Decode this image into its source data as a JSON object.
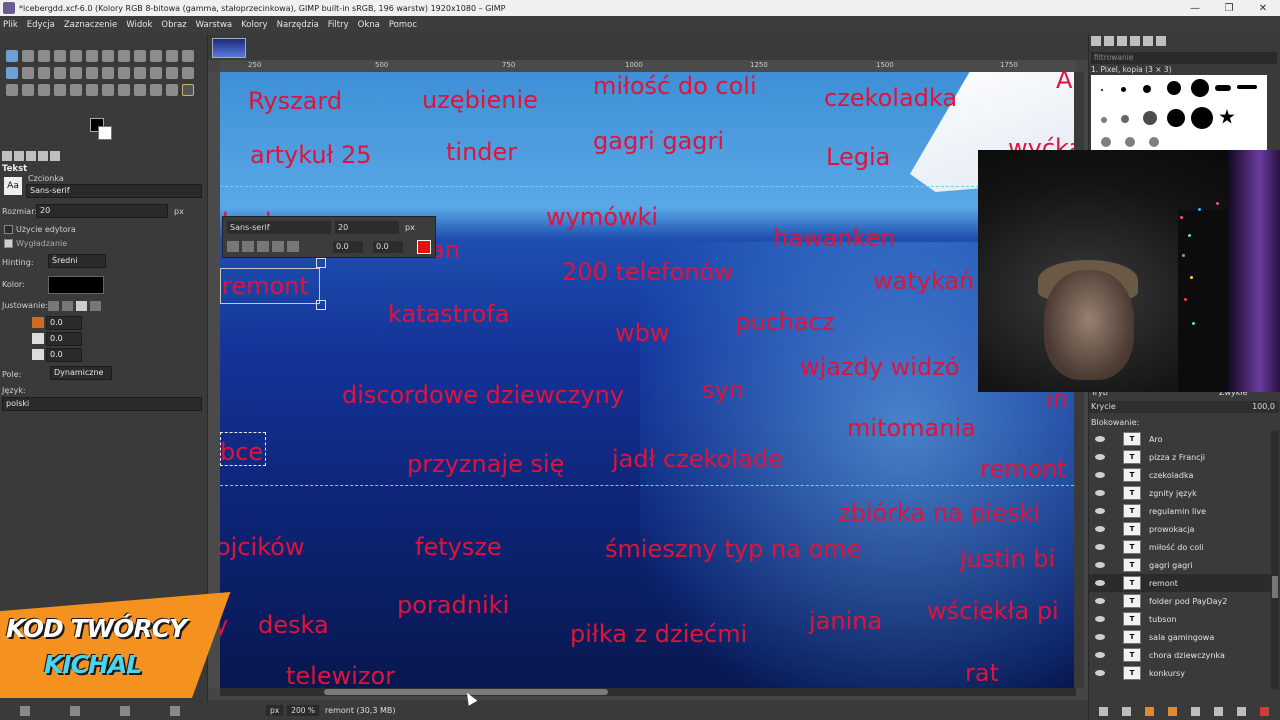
{
  "window": {
    "title": "*icebergdd.xcf-6.0 (Kolory RGB 8-bitowa (gamma, stałoprzecinkowa), GIMP built-in sRGB, 196 warstw) 1920x1080 – GIMP",
    "minimize": "—",
    "maximize": "❐",
    "close": "✕"
  },
  "menu": [
    "Plik",
    "Edycja",
    "Zaznaczenie",
    "Widok",
    "Obraz",
    "Warstwa",
    "Kolory",
    "Narzędzia",
    "Filtry",
    "Okna",
    "Pomoc"
  ],
  "tool_options": {
    "heading": "Tekst",
    "font_label": "Czcionka",
    "font_value": "Sans-serif",
    "size_label": "Rozmiar:",
    "size_value": "20",
    "size_unit": "px",
    "use_editor": "Użycie edytora",
    "antialias": "Wygładzanie",
    "hinting_label": "Hinting:",
    "hinting_value": "Średni",
    "color_label": "Kolor:",
    "justify_label": "Justowanie:",
    "indent_value": "0.0",
    "line_spacing_value": "0.0",
    "letter_spacing_value": "0.0",
    "box_label": "Pole:",
    "box_value": "Dynamiczne",
    "language_label": "Język:",
    "language_value": "polski"
  },
  "badge": {
    "line1": "KOD TWÓRCY",
    "line2": "KICHAL"
  },
  "ruler_marks": [
    "250",
    "500",
    "750",
    "1000",
    "1250",
    "1500",
    "1750"
  ],
  "text_popup": {
    "font": "Sans-serif",
    "size": "20",
    "unit": "px",
    "baseline": "0.0",
    "kerning": "0.0",
    "color": "#e61010"
  },
  "canvas_words": [
    "Ryszard",
    "uzębienie",
    "miłość do coli",
    "czekoladka",
    "A",
    "artykuł 25",
    "tinder",
    "gagri gagri",
    "Legia",
    "wyćkan",
    "konkursy",
    "wymówki",
    "hawanken",
    "an",
    "200 telefonów",
    "watykań",
    "remont",
    "katastrofa",
    "puchacz",
    "wbw",
    "wjazdy widzó",
    "syn",
    "discordowe dziewczyny",
    "in",
    "mitomania",
    "bce",
    "przyznaje się",
    "jadł czekolade",
    "remont",
    "zbiórka na pieski",
    "ojcików",
    "fetysze",
    "śmieszny typ na ome",
    "justin bi",
    "poradniki",
    "y",
    "deska",
    "piłka z dziećmi",
    "janina",
    "wściekła pi",
    "telewizor",
    "rat"
  ],
  "status": {
    "unit": "px",
    "zoom": "200 %",
    "layer_info": "remont (30,3 MB)"
  },
  "right_dock": {
    "filter_placeholder": "filtrowanie",
    "brush_name": "1. Pixel, kopia (3 × 3)",
    "mode_label": "Tryb",
    "mode_value": "Zwykłe",
    "opacity_label": "Krycie",
    "opacity_value": "100,0",
    "lock_label": "Blokowanie:"
  },
  "layers": [
    {
      "name": "Aro",
      "selected": false
    },
    {
      "name": "pizza z Francji",
      "selected": false
    },
    {
      "name": "czekoladka",
      "selected": false
    },
    {
      "name": "zgnity język",
      "selected": false
    },
    {
      "name": "regulamin live",
      "selected": false
    },
    {
      "name": "prowokacja",
      "selected": false
    },
    {
      "name": "miłość do coli",
      "selected": false
    },
    {
      "name": "gagri gagri",
      "selected": false
    },
    {
      "name": "remont",
      "selected": true
    },
    {
      "name": "folder pod PayDay2",
      "selected": false
    },
    {
      "name": "tubson",
      "selected": false
    },
    {
      "name": "sala gamingowa",
      "selected": false
    },
    {
      "name": "chora dziewczynka",
      "selected": false
    },
    {
      "name": "konkursy",
      "selected": false
    }
  ]
}
